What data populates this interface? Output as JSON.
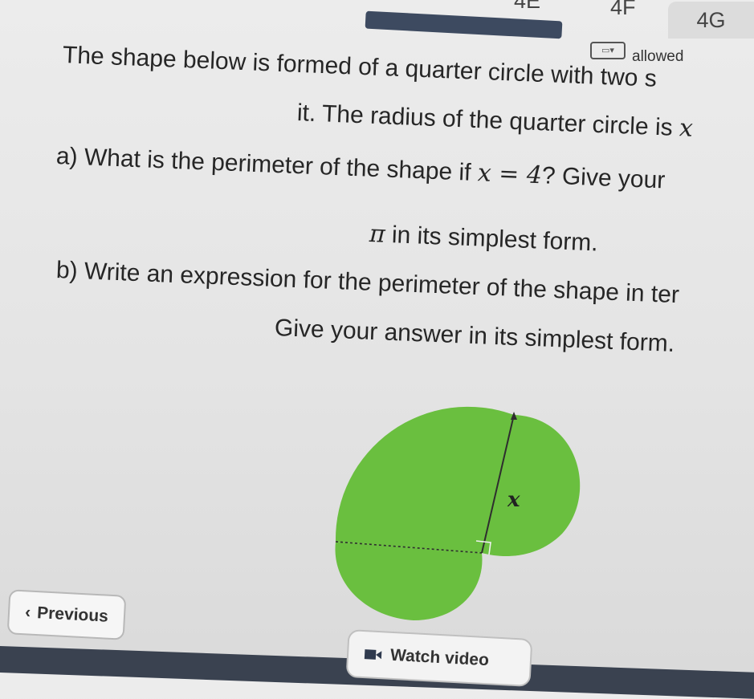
{
  "tabs": [
    "4E",
    "4F",
    "4G"
  ],
  "calculator": {
    "badge": "▭▾",
    "label": "allowed"
  },
  "question": {
    "line1": "The shape below is formed of a quarter circle with two s",
    "line2_pre": "it. The radius of the quarter circle is ",
    "line2_var": "x",
    "line3_pre": "a) What is the perimeter of the shape if ",
    "line3_math": "x = 4",
    "line3_post": "? Give your",
    "line4_sym": "π",
    "line4_post": " in its simplest form.",
    "line5": "b) Write an expression for the perimeter of the shape in ter",
    "line6": "Give your answer in its simplest form."
  },
  "diagram": {
    "label": "x",
    "fill": "#6abf3f",
    "stroke": "#2e2e2e"
  },
  "buttons": {
    "previous": "Previous",
    "watch_video": "Watch video"
  },
  "icons": {
    "previous": "chevron-left-icon",
    "watch": "video-icon"
  }
}
